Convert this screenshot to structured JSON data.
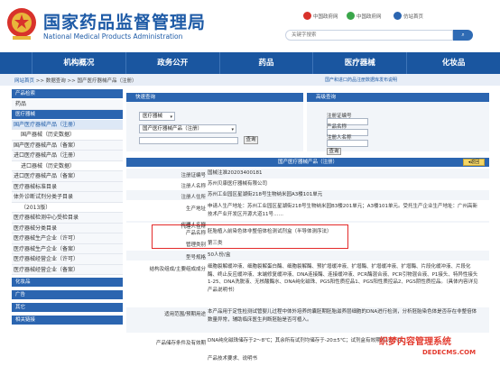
{
  "header": {
    "title_cn": "国家药品监督管理局",
    "title_en": "National Medical Products Administration",
    "social": [
      "中国政府网",
      "中国政府网",
      "仿站首页"
    ],
    "search_placeholder": "关键字搜索",
    "search_button": "搜索"
  },
  "nav": [
    "",
    "机构概况",
    "政务公开",
    "药品",
    "医疗器械",
    "化妆品"
  ],
  "breadcrumb": {
    "home": "网站首页",
    "rest": ">> 数据查询 >> 国产医疗器械产品（注册）",
    "note": "国产和进口药品注册数据库发布说明"
  },
  "sidebar": {
    "head1": "产品检索",
    "head2": "药品",
    "head3": "医疗器械",
    "items": [
      "国产医疗器械产品（注册）",
      "国产器械（历史数据）",
      "国产医疗器械产品（备案）",
      "进口医疗器械产品（注册）",
      "进口器械（历史数据）",
      "进口医疗器械产品（备案）",
      "医疗器械标准目录",
      "体外诊断试剂分类子目录",
      "（2013版）",
      "医疗器械检测中心受检目录",
      "医疗器械分类目录",
      "医疗器械生产企业（许可）",
      "医疗器械生产企业（备案）",
      "医疗器械经营企业（许可）",
      "医疗器械经营企业（备案）"
    ],
    "head4": "化妆品",
    "head5": "广告",
    "head6": "其它",
    "head7": "相关链接"
  },
  "search": {
    "head_left": "快速查询",
    "head_right": "高级查询",
    "select1": "医疗器械",
    "select2": "国产医疗器械产品（注册）",
    "query_button": "查询",
    "field1": "注册证编号",
    "field2": "产品名称",
    "field3": "注册人名称",
    "query_button2": "查询"
  },
  "detail": {
    "head": "国产医疗器械产品（注册）",
    "back": "返回",
    "rows": [
      {
        "label": "注册证编号",
        "value": "国械注准20203400181"
      },
      {
        "label": "注册人名称",
        "value": "苏州贝康医疗器械有限公司"
      },
      {
        "label": "注册人住所",
        "value": "苏州工业园区星湖街218号生物纳米园A3楼101单元"
      },
      {
        "label": "生产地址",
        "value": "申请人生产地址：苏州工业园区星湖街218号生物纳米园B3楼201单元；A3楼101单元。受托生产企业生产地址：广州高新技术产业开发区开源大道11号……"
      },
      {
        "label": "代理人名称",
        "value": ""
      },
      {
        "label": "代理人住所",
        "value": ""
      },
      {
        "label": "产品名称",
        "value": "胚胎植入前染色体非整倍体检测试剂盒（半导体测序法）"
      },
      {
        "label": "管理类别",
        "value": "第三类"
      },
      {
        "label": "型号规格",
        "value": "50人份/盒"
      },
      {
        "label": "结构及组成/主要组成成分",
        "value": "细胞裂解缓冲液、细胞裂解蛋白酶、细胞裂解酶、预扩增缓冲液、扩增酶、扩增缓冲液、扩增酶、片段化缓冲液、片段化酶、终止反应缓冲液、末端修复缓冲液、DNA连接酶、连接缓冲液、PCR酶混合液、PCR引物混合液、P1接头、特异性接头1-25、DNA洗脱液、无核酸酶水、DNA纯化磁珠、PGS阳性质控品1、PGS阳性质控品2、PGS阴性质控品。（具体内容详见产品说明书）"
      },
      {
        "label": "适用范围/预期用途",
        "value": "本产品用于定性检测试管婴儿过程中体外培养的囊胚期胚胎滋养层细胞的DNA进行检测，分析胚胎染色体是否存在非整倍体数量异常，辅助临床医生判断胚胎是否可植入。"
      },
      {
        "label": "产品储存条件及有效期",
        "value": "DNA纯化磁珠储存于2～8℃；其余所有试剂均储存于-20±5℃；试剂盒有效期为12个月。"
      },
      {
        "label": "",
        "value": "产品技术要求、说明书"
      }
    ]
  },
  "watermark": {
    "line1": "织梦内容管理系统",
    "line2": "DEDECMS.COM"
  }
}
